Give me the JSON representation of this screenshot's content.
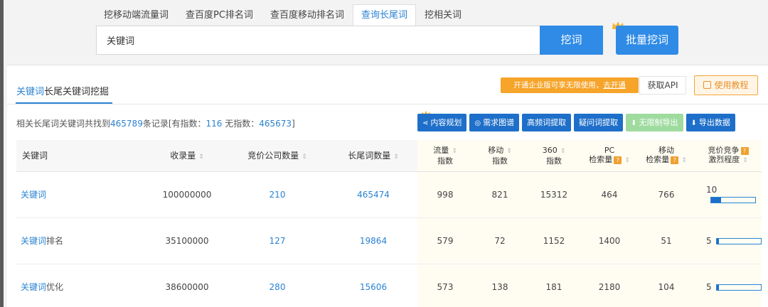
{
  "tabs": [
    {
      "label": "挖移动端流量词"
    },
    {
      "label": "查百度PC排名词"
    },
    {
      "label": "查百度移动排名词"
    },
    {
      "label": "查询长尾词",
      "active": true
    },
    {
      "label": "挖相关词"
    }
  ],
  "search": {
    "value": "关键词"
  },
  "buttons": {
    "dig": "挖词",
    "batch_dig": "批量挖词"
  },
  "panel": {
    "title_highlight": "关键词",
    "title_rest": "长尾关键词挖掘",
    "promo_text": "开通企业版可享无限使用，",
    "promo_link": "去开通",
    "api_label": "获取API",
    "tutorial_label": "使用教程"
  },
  "summary": {
    "prefix": "相关长尾词关键词共找到",
    "total": "465789",
    "mid1": "条记录[有指数：",
    "with_index": "116",
    "mid2": " 无指数：",
    "without_index": "465673",
    "suffix": "]"
  },
  "actions": [
    {
      "label": "内容规划",
      "icon": "share-icon"
    },
    {
      "label": "需求图谱",
      "icon": "eye-icon"
    },
    {
      "label": "高频词提取"
    },
    {
      "label": "疑问词提取"
    },
    {
      "label": "无限制导出",
      "icon": "download-icon",
      "disabled": true
    },
    {
      "label": "导出数据",
      "icon": "download-icon"
    }
  ],
  "table": {
    "headers": {
      "keyword": "关键词",
      "indexed": "收录量",
      "bid_companies": "竞价公司数量",
      "longtail": "长尾词数量",
      "traffic_1": "流量",
      "traffic_2": "指数",
      "mobile_1": "移动",
      "mobile_2": "指数",
      "i360_1": "360",
      "i360_2": "指数",
      "pc_1": "PC",
      "pc_2": "检索量",
      "mob_search_1": "移动",
      "mob_search_2": "检索量",
      "comp_1": "竞价竞争",
      "comp_2": "激烈程度"
    },
    "rows": [
      {
        "kw_a": "关键词",
        "kw_b": "",
        "indexed": "100000000",
        "bid": "210",
        "longtail": "465474",
        "traffic": "998",
        "mobile": "821",
        "i360": "15312",
        "pc": "464",
        "mob_search": "766",
        "competition": "10",
        "competition_fill": 0.22
      },
      {
        "kw_a": "关键词",
        "kw_b": "排名",
        "indexed": "35100000",
        "bid": "127",
        "longtail": "19864",
        "traffic": "579",
        "mobile": "72",
        "i360": "1152",
        "pc": "1400",
        "mob_search": "51",
        "competition": "5",
        "competition_fill": 0.06
      },
      {
        "kw_a": "关键词",
        "kw_b": "优化",
        "indexed": "38600000",
        "bid": "280",
        "longtail": "15606",
        "traffic": "573",
        "mobile": "138",
        "i360": "181",
        "pc": "2180",
        "mob_search": "104",
        "competition": "5",
        "competition_fill": 0.06
      }
    ]
  }
}
